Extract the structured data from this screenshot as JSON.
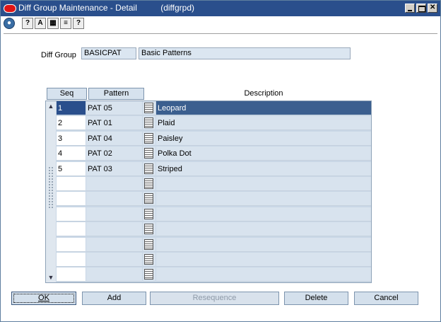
{
  "window": {
    "title": "Diff Group Maintenance - Detail",
    "module": "(diffgrpd)"
  },
  "toolbar": {
    "icons": [
      "globe-icon",
      "help-book-icon",
      "spell-icon",
      "calendar-icon",
      "notes-icon",
      "help-icon"
    ],
    "glyphs": [
      "●",
      "?",
      "A",
      "▦",
      "≡",
      "?"
    ]
  },
  "diff_group": {
    "label": "Diff Group",
    "id": "BASICPAT",
    "description": "Basic Patterns"
  },
  "grid": {
    "headers": {
      "seq": "Seq",
      "pattern": "Pattern",
      "description": "Description"
    },
    "rows": [
      {
        "seq": "1",
        "pattern": "PAT 05",
        "description": "Leopard"
      },
      {
        "seq": "2",
        "pattern": "PAT 01",
        "description": "Plaid"
      },
      {
        "seq": "3",
        "pattern": "PAT 04",
        "description": "Paisley"
      },
      {
        "seq": "4",
        "pattern": "PAT 02",
        "description": "Polka Dot"
      },
      {
        "seq": "5",
        "pattern": "PAT 03",
        "description": "Striped"
      },
      {
        "seq": "",
        "pattern": "",
        "description": ""
      },
      {
        "seq": "",
        "pattern": "",
        "description": ""
      },
      {
        "seq": "",
        "pattern": "",
        "description": ""
      },
      {
        "seq": "",
        "pattern": "",
        "description": ""
      },
      {
        "seq": "",
        "pattern": "",
        "description": ""
      },
      {
        "seq": "",
        "pattern": "",
        "description": ""
      },
      {
        "seq": "",
        "pattern": "",
        "description": ""
      }
    ]
  },
  "buttons": {
    "ok": "OK",
    "add": "Add",
    "resequence": "Resequence",
    "delete": "Delete",
    "cancel": "Cancel"
  },
  "colors": {
    "titlebar": "#2a4f8c",
    "selected_row": "#3b5f8f",
    "cell_bg": "#d8e3ee"
  }
}
